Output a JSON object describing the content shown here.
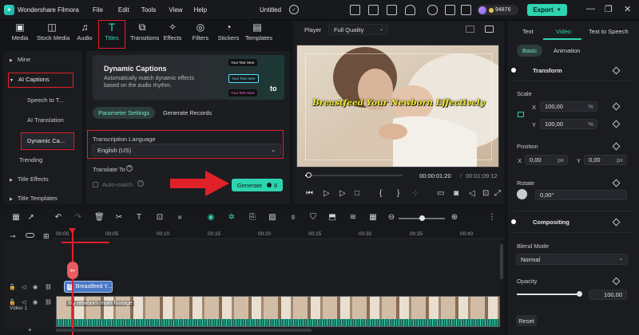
{
  "app": {
    "logo_text": "Wondershare Filmora",
    "doc_title": "Untitled",
    "credits": "94876",
    "export_label": "Export",
    "menu": [
      "File",
      "Edit",
      "Tools",
      "View",
      "Help"
    ]
  },
  "tool_tabs": [
    {
      "label": "Media",
      "icon": "media-icon"
    },
    {
      "label": "Stock Media",
      "icon": "stock-media-icon"
    },
    {
      "label": "Audio",
      "icon": "audio-icon"
    },
    {
      "label": "Titles",
      "icon": "titles-icon"
    },
    {
      "label": "Transitions",
      "icon": "transitions-icon"
    },
    {
      "label": "Effects",
      "icon": "effects-icon"
    },
    {
      "label": "Filters",
      "icon": "filters-icon"
    },
    {
      "label": "Stickers",
      "icon": "stickers-icon"
    },
    {
      "label": "Templates",
      "icon": "templates-icon"
    }
  ],
  "sidebar": {
    "items": [
      "Mine",
      "AI Captions",
      "Speech to T...",
      "AI Translation",
      "Dynamic Ca...",
      "Trending",
      "Title Effects",
      "Title Templates"
    ]
  },
  "captions": {
    "card_title": "Dynamic Captions",
    "card_desc": "Automatically match dynamic effects based on the audio rhythm.",
    "preview_labels": [
      "Your Text Here",
      "Your Text Here",
      "Your Text Here",
      "to"
    ],
    "tabs": [
      "Parameter Settings",
      "Generate Records"
    ],
    "lang_label": "Transcription Language",
    "lang_value": "English (US)",
    "translate_label": "Translate To",
    "automatch_label": "Auto-match",
    "generate_label": "Generate",
    "generate_count": "8"
  },
  "player": {
    "label": "Player",
    "quality": "Full Quality",
    "caption": "Breastfeed Your Newborn Effectively",
    "time_current": "00:00:01:20",
    "time_total": "00:01:09:12",
    "progress": 0.03
  },
  "props": {
    "tabs": [
      "Text",
      "Video",
      "Text to Speech"
    ],
    "subtabs": [
      "Basic",
      "Animation"
    ],
    "transform": "Transform",
    "scale": "Scale",
    "scale_x": "100,00",
    "scale_y": "100,00",
    "pct": "%",
    "position": "Position",
    "pos_x": "0,00",
    "pos_y": "0,00",
    "px": "px",
    "rotate": "Rotate",
    "rotate_value": "0,00°",
    "compositing": "Compositing",
    "blend_mode": "Blend Mode",
    "blend_value": "Normal",
    "opacity": "Opacity",
    "opacity_value": "100,00",
    "reset": "Reset",
    "x": "X",
    "y": "Y"
  },
  "timeline": {
    "ruler": [
      "00:00",
      "00:05",
      "00:10",
      "00:15",
      "00:20",
      "00:25",
      "00:30",
      "00:35",
      "00:40"
    ],
    "title_clip": "Breastfeed Y...",
    "video_clip": "my newborn mom footage",
    "video_track": "Video 1"
  },
  "colors": {
    "accent": "#2ed4b0",
    "highlight": "#e0212a",
    "caption_yellow": "#f2ea2a"
  }
}
